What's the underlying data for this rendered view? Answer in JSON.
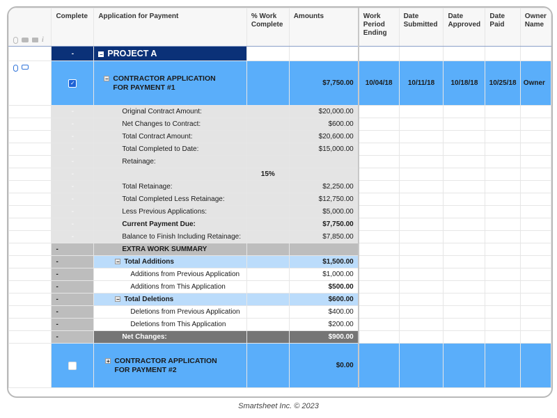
{
  "header": {
    "columns": [
      {
        "key": "complete",
        "label": "Complete"
      },
      {
        "key": "application",
        "label": "Application for Payment"
      },
      {
        "key": "work_complete",
        "label": "% Work Complete"
      },
      {
        "key": "amounts",
        "label": "Amounts"
      },
      {
        "key": "work_period",
        "label": "Work Period Ending"
      },
      {
        "key": "date_submitted",
        "label": "Date Submitted"
      },
      {
        "key": "date_approved",
        "label": "Date Approved"
      },
      {
        "key": "date_paid",
        "label": "Date Paid"
      },
      {
        "key": "owner_name",
        "label": "Owner Name"
      }
    ],
    "rail_icons": [
      "attachment-icon",
      "comment-icon",
      "proof-icon",
      "info-icon"
    ]
  },
  "project": {
    "complete": "-",
    "title": "PROJECT A"
  },
  "contract1": {
    "checked": true,
    "title": "CONTRACTOR APPLICATION FOR PAYMENT #1",
    "amount": "$7,750.00",
    "work_period": "10/04/18",
    "date_submitted": "10/11/18",
    "date_approved": "10/18/18",
    "date_paid": "10/25/18",
    "owner_name": "Owner"
  },
  "summary_rows": [
    {
      "label": "Original Contract Amount:",
      "pct": "",
      "amount": "$20,000.00",
      "bold": false
    },
    {
      "label": "Net Changes to Contract:",
      "pct": "",
      "amount": "$600.00",
      "bold": false
    },
    {
      "label": "Total Contract Amount:",
      "pct": "",
      "amount": "$20,600.00",
      "bold": false
    },
    {
      "label": "Total Completed to Date:",
      "pct": "",
      "amount": "$15,000.00",
      "bold": false
    },
    {
      "label": "Retainage:",
      "pct": "",
      "amount": "",
      "bold": false
    },
    {
      "label": "",
      "pct": "15%",
      "amount": "",
      "bold": false
    },
    {
      "label": "Total Retainage:",
      "pct": "",
      "amount": "$2,250.00",
      "bold": false
    },
    {
      "label": "Total Completed Less Retainage:",
      "pct": "",
      "amount": "$12,750.00",
      "bold": false
    },
    {
      "label": "Less Previous Applications:",
      "pct": "",
      "amount": "$5,000.00",
      "bold": false
    },
    {
      "label": "Current Payment Due:",
      "pct": "",
      "amount": "$7,750.00",
      "bold": true
    },
    {
      "label": "Balance to Finish Including Retainage:",
      "pct": "",
      "amount": "$7,850.00",
      "bold": false
    }
  ],
  "summary_dash": "-",
  "extra": {
    "dash": "-",
    "title": "EXTRA WORK SUMMARY",
    "additions": {
      "label": "Total Additions",
      "amount": "$1,500.00"
    },
    "additions_prev": {
      "label": "Additions from Previous Application",
      "amount": "$1,000.00"
    },
    "additions_this": {
      "label": "Additions from This Application",
      "amount": "$500.00"
    },
    "deletions": {
      "label": "Total Deletions",
      "amount": "$600.00"
    },
    "deletions_prev": {
      "label": "Deletions from Previous Application",
      "amount": "$400.00"
    },
    "deletions_this": {
      "label": "Deletions from This Application",
      "amount": "$200.00"
    },
    "net": {
      "label": "Net Changes:",
      "amount": "$900.00"
    }
  },
  "contract2": {
    "checked": false,
    "title": "CONTRACTOR APPLICATION FOR PAYMENT #2",
    "amount": "$0.00"
  },
  "footer": "Smartsheet Inc. © 2023",
  "colors": {
    "project_bg": "#0b3178",
    "contract_bg": "#5aaefa",
    "total_bg": "#bbdcfb",
    "net_bg": "#757575",
    "gray_bg": "#e4e4e4"
  }
}
